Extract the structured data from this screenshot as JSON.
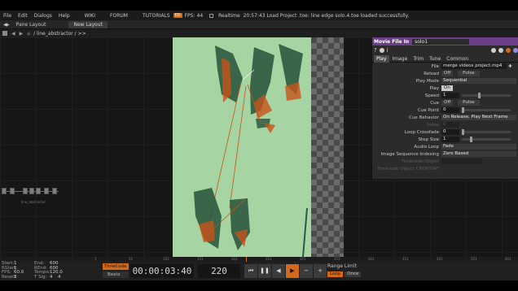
{
  "menubar": {
    "items": [
      "File",
      "Edit",
      "Dialogs",
      "Help"
    ],
    "wiki": "WIKI",
    "forum": "FORUM",
    "tutorials": "TUTORIALS",
    "tutorials_badge": "ED",
    "fps_label": "FPS:",
    "fps_value": "44",
    "realtime": "Realtime",
    "message": "20:57:43 Load Project .toe: line edge solo.4.toe loaded successfully."
  },
  "panebar": {
    "pane_layout": "Pane Layout",
    "new_layout": "New Layout"
  },
  "pathbar": {
    "path": "/ line_abstractor / >>"
  },
  "network": {
    "node_label": "line_abstractor"
  },
  "params": {
    "op_type": "Movie File In",
    "op_name": "solo1",
    "tabs": [
      "Play",
      "Image",
      "Trim",
      "Tune",
      "Common"
    ],
    "rows": {
      "file_label": "File",
      "file_value": "merge videos project.mp4",
      "reload_label": "Reload",
      "reload_toggle": "Off",
      "reload_pulse": "Pulse",
      "playmode_label": "Play Mode",
      "playmode_value": "Sequential",
      "play_label": "Play",
      "play_toggle": "On",
      "speed_label": "Speed",
      "speed_value": "1",
      "cue_label": "Cue",
      "cue_toggle": "Off",
      "cue_pulse": "Pulse",
      "cuepoint_label": "Cue Point",
      "cuepoint_value": "0",
      "cuebehavior_label": "Cue Behavior",
      "cuebehavior_value": "On Release, Play Next Frame",
      "index_label": "Index",
      "index_value": "0",
      "loopcrossfade_label": "Loop Crossfade",
      "loopcrossfade_value": "0",
      "stepsize_label": "Step Size",
      "stepsize_value": "1",
      "audioloop_label": "Audio Loop",
      "audioloop_value": "Fade",
      "imgseq_label": "Image Sequence Indexing",
      "imgseq_value": "Zero Based",
      "timecodeop_label": "Timecode Object",
      "timecodechop_label": "Timecode Object CHOP/DAT"
    }
  },
  "ruler": {
    "ticks": [
      "1",
      "51",
      "101",
      "151",
      "201",
      "251",
      "301",
      "351",
      "401",
      "451",
      "501",
      "551",
      "601"
    ]
  },
  "timeline": {
    "start_label": "Start:",
    "start_value": "1",
    "end_label": "End:",
    "end_value": "600",
    "rstart_label": "RStart:",
    "rstart_value": "1",
    "rend_label": "REnd:",
    "rend_value": "600",
    "fps_label": "FPS:",
    "fps_value": "60.0",
    "tempo_label": "Tempo:",
    "tempo_value": "120.0",
    "resetf_label": "ResetF:",
    "resetf_value": "1",
    "tsig_label": "T Sig:",
    "tsig_value": "4",
    "tsig_value2": "4",
    "timecode_btn": "TimeCode",
    "beats_btn": "Beats",
    "timecode": "00:00:03:40",
    "frame": "220",
    "range_label": "Range Limit",
    "loop": "Loop",
    "once": "Once"
  },
  "colors": {
    "accent": "#d36a1a",
    "op_header": "#6b3f88",
    "viewer_bg": "#a7d4a3"
  }
}
